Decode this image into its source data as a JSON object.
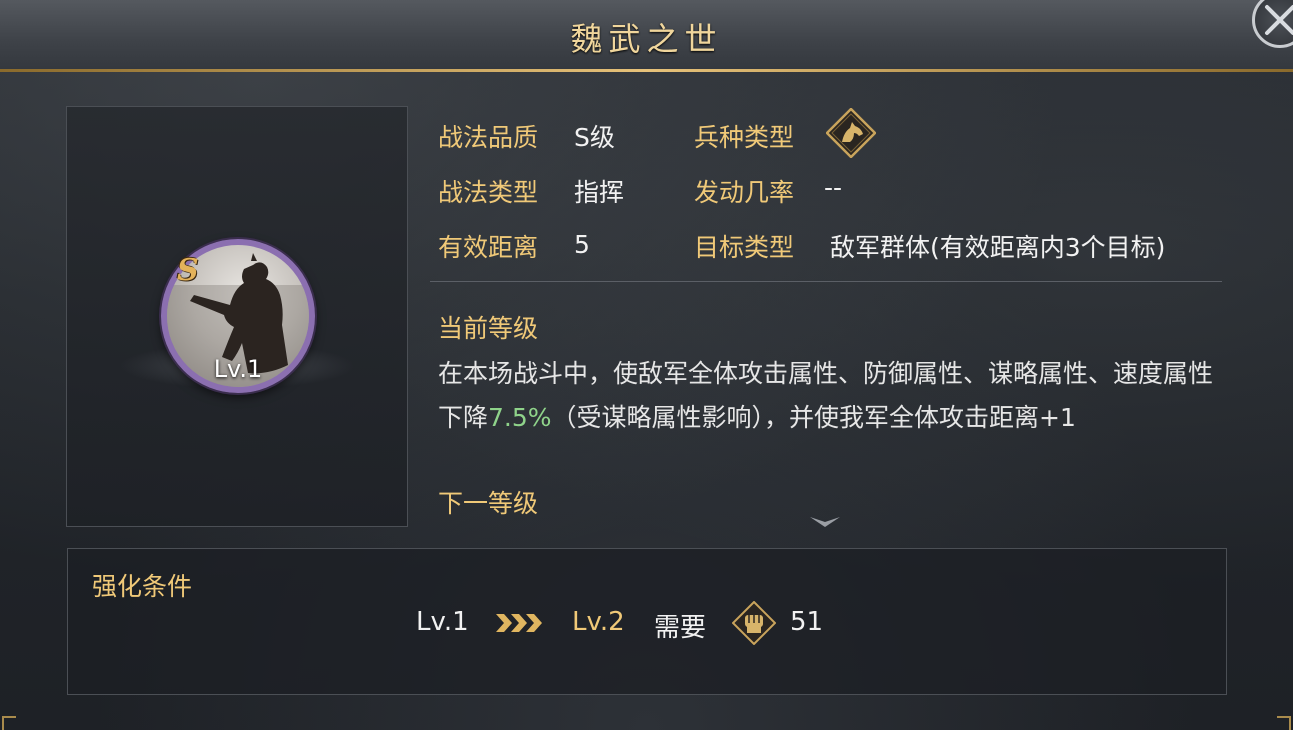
{
  "title": "魏武之世",
  "skill": {
    "grade_badge": "S",
    "level": "Lv.1"
  },
  "info": {
    "quality_label": "战法品质",
    "quality_value": "S级",
    "troop_label": "兵种类型",
    "troop_icon": "cavalry-horse-icon",
    "type_label": "战法类型",
    "type_value": "指挥",
    "rate_label": "发动几率",
    "rate_value": "--",
    "range_label": "有效距离",
    "range_value": "5",
    "target_label": "目标类型",
    "target_value": "敌军群体(有效距离内3个目标)"
  },
  "levels": {
    "current_heading": "当前等级",
    "desc_part1": "在本场战斗中，使敌军全体攻击属性、防御属性、谋略属性、速度属性下降",
    "desc_highlight": "7.5%",
    "desc_part2": "（受谋略属性影响），并使我军全体攻击距离+1",
    "next_heading": "下一等级"
  },
  "upgrade": {
    "title": "强化条件",
    "from_level": "Lv.1",
    "to_level": "Lv.2",
    "require_label": "需要",
    "cost": "51",
    "cost_icon": "fist-icon"
  },
  "colors": {
    "accent_gold": "#f0c978",
    "highlight_green": "#8fd38a",
    "ring_purple": "#8b6fb0"
  }
}
